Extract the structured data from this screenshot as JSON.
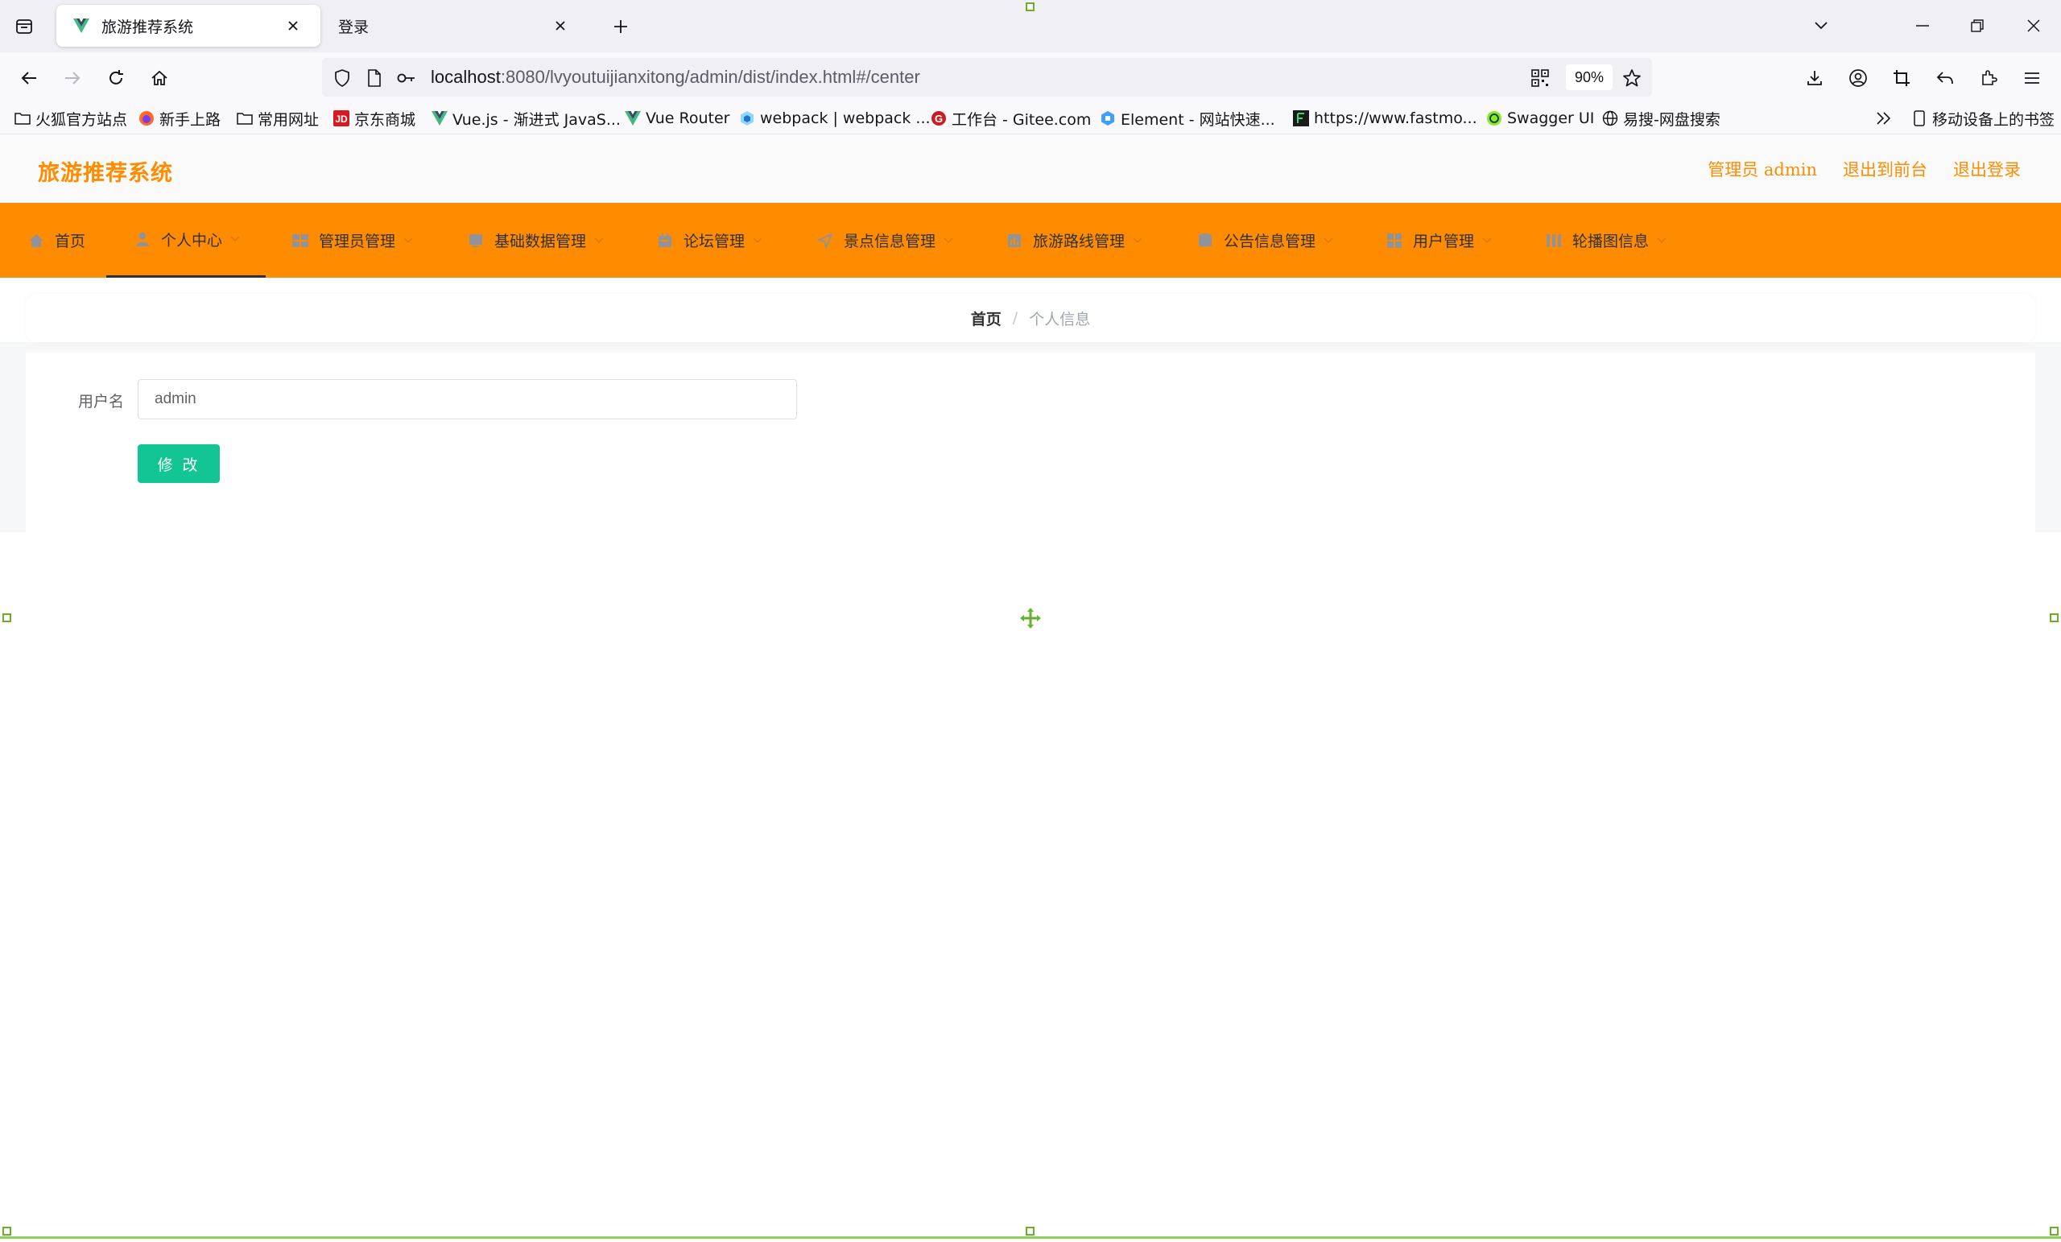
{
  "browser": {
    "tabs": [
      {
        "title": "旅游推荐系统",
        "active": true
      },
      {
        "title": "登录",
        "active": false
      }
    ],
    "url_host": "localhost",
    "url_rest": ":8080/lvyoutuijianxitong/admin/dist/index.html#/center",
    "zoom": "90%",
    "bookmarks": [
      {
        "label": "火狐官方站点",
        "icon": "folder-icon"
      },
      {
        "label": "新手上路",
        "icon": "firefox-icon"
      },
      {
        "label": "常用网址",
        "icon": "folder-icon"
      },
      {
        "label": "京东商城",
        "icon": "jd-icon"
      },
      {
        "label": "Vue.js - 渐进式 JavaS...",
        "icon": "vue-icon"
      },
      {
        "label": "Vue Router",
        "icon": "vue-icon"
      },
      {
        "label": "webpack | webpack ...",
        "icon": "webpack-icon"
      },
      {
        "label": "工作台 - Gitee.com",
        "icon": "gitee-icon"
      },
      {
        "label": "Element - 网站快速...",
        "icon": "element-icon"
      },
      {
        "label": "https://www.fastmo...",
        "icon": "fastmock-icon"
      },
      {
        "label": "Swagger UI",
        "icon": "swagger-icon"
      },
      {
        "label": "易搜-网盘搜索",
        "icon": "globe-icon"
      }
    ],
    "mobile_bookmarks": "移动设备上的书签"
  },
  "app": {
    "brand": "旅游推荐系统",
    "header_links": {
      "user": "管理员 admin",
      "front": "退出到前台",
      "logout": "退出登录"
    },
    "menu": [
      {
        "label": "首页",
        "icon": "home-icon",
        "caret": false
      },
      {
        "label": "个人中心",
        "icon": "user-icon",
        "caret": true,
        "active": true
      },
      {
        "label": "管理员管理",
        "icon": "admin-icon",
        "caret": true
      },
      {
        "label": "基础数据管理",
        "icon": "data-icon",
        "caret": true
      },
      {
        "label": "论坛管理",
        "icon": "forum-icon",
        "caret": true
      },
      {
        "label": "景点信息管理",
        "icon": "location-icon",
        "caret": true
      },
      {
        "label": "旅游路线管理",
        "icon": "route-icon",
        "caret": true
      },
      {
        "label": "公告信息管理",
        "icon": "notice-icon",
        "caret": true
      },
      {
        "label": "用户管理",
        "icon": "users-icon",
        "caret": true
      },
      {
        "label": "轮播图信息",
        "icon": "carousel-icon",
        "caret": true
      }
    ],
    "breadcrumb": {
      "home": "首页",
      "separator": "/",
      "current": "个人信息"
    },
    "form": {
      "username_label": "用户名",
      "username_value": "admin",
      "submit_label": "修 改"
    },
    "colors": {
      "accent": "#ff8c00",
      "button": "#13c495"
    }
  }
}
